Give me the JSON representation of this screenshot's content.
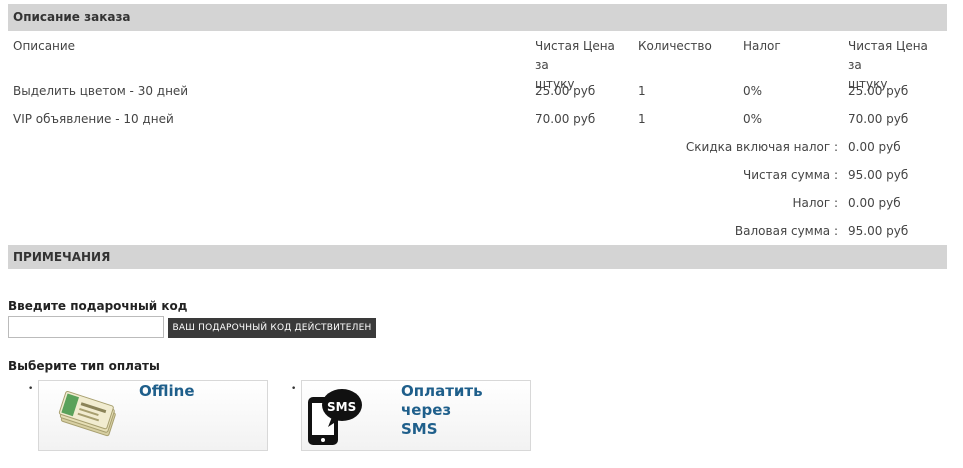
{
  "order": {
    "section_title": "Описание заказа",
    "headers": {
      "description": "Описание",
      "unit_price_line1": "Чистая Цена за",
      "unit_price_line2": "штуку",
      "quantity": "Количество",
      "tax": "Налог",
      "total_line1": "Чистая Цена за",
      "total_line2": "штуку"
    },
    "rows": [
      {
        "description": "Выделить цветом - 30 дней",
        "price": "25.00 руб",
        "qty": "1",
        "tax": "0%",
        "total": "25.00 руб"
      },
      {
        "description": "VIP объявление - 10 дней",
        "price": "70.00 руб",
        "qty": "1",
        "tax": "0%",
        "total": "70.00 руб"
      }
    ],
    "summary": [
      {
        "label": "Скидка включая налог :",
        "value": "0.00 руб"
      },
      {
        "label": "Чистая сумма :",
        "value": "95.00 руб"
      },
      {
        "label": "Налог :",
        "value": "0.00 руб"
      },
      {
        "label": "Валовая сумма :",
        "value": "95.00 руб"
      }
    ]
  },
  "notes": {
    "section_title": "ПРИМЕЧАНИЯ"
  },
  "gift": {
    "label": "Введите подарочный код",
    "input_value": "",
    "button_label": "ВАШ ПОДАРОЧНЫЙ КОД ДЕЙСТВИТЕЛЕН"
  },
  "payment": {
    "label": "Выберите тип оплаты",
    "bullet": "•",
    "options": [
      {
        "title": "Offline",
        "icon": "cash-icon"
      },
      {
        "title_line1": "Оплатить через",
        "title_line2": "SMS",
        "icon": "sms-phone-icon",
        "icon_text": "SMS"
      }
    ]
  }
}
